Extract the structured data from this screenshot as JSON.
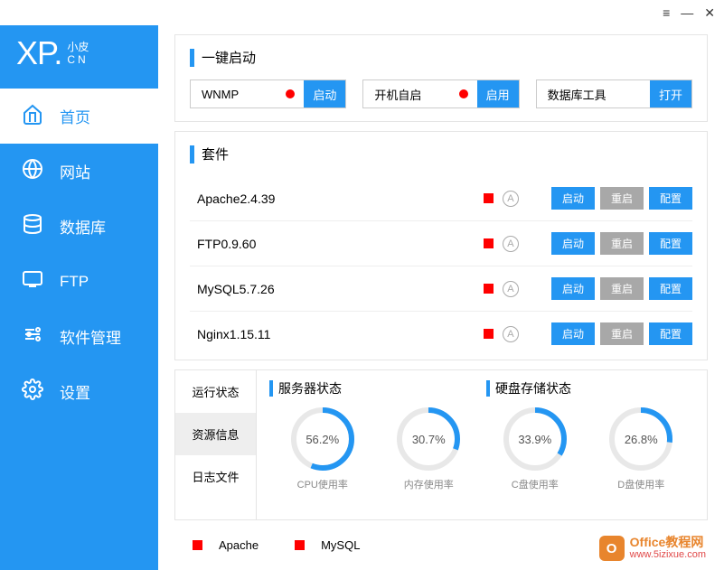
{
  "window": {
    "menu": "≡",
    "min": "—",
    "close": "✕"
  },
  "logo": {
    "main": "XP.",
    "sub1": "小皮",
    "sub2": "CN"
  },
  "nav": [
    {
      "key": "home",
      "label": "首页",
      "active": true
    },
    {
      "key": "site",
      "label": "网站",
      "active": false
    },
    {
      "key": "db",
      "label": "数据库",
      "active": false
    },
    {
      "key": "ftp",
      "label": "FTP",
      "active": false
    },
    {
      "key": "soft",
      "label": "软件管理",
      "active": false
    },
    {
      "key": "settings",
      "label": "设置",
      "active": false
    }
  ],
  "quickstart": {
    "title": "一键启动",
    "items": [
      {
        "label": "WNMP",
        "dot": true,
        "btn": "启动"
      },
      {
        "label": "开机自启",
        "dot": true,
        "btn": "启用"
      },
      {
        "label": "数据库工具",
        "dot": false,
        "btn": "打开"
      }
    ]
  },
  "suites": {
    "title": "套件",
    "rows": [
      {
        "name": "Apache2.4.39",
        "btns": [
          "启动",
          "重启",
          "配置"
        ]
      },
      {
        "name": "FTP0.9.60",
        "btns": [
          "启动",
          "重启",
          "配置"
        ]
      },
      {
        "name": "MySQL5.7.26",
        "btns": [
          "启动",
          "重启",
          "配置"
        ]
      },
      {
        "name": "Nginx1.15.11",
        "btns": [
          "启动",
          "重启",
          "配置"
        ]
      }
    ],
    "badge": "A"
  },
  "status": {
    "tabs": [
      "运行状态",
      "资源信息",
      "日志文件"
    ],
    "active_tab": 1,
    "header1": "服务器状态",
    "header2": "硬盘存储状态",
    "gauges": [
      {
        "pct": 56.2,
        "label": "CPU使用率"
      },
      {
        "pct": 30.7,
        "label": "内存使用率"
      },
      {
        "pct": 33.9,
        "label": "C盘使用率"
      },
      {
        "pct": 26.8,
        "label": "D盘使用率"
      }
    ]
  },
  "footer": {
    "items": [
      "Apache",
      "MySQL"
    ]
  },
  "watermark": {
    "badge": "O",
    "line1": "Office教程网",
    "line2": "www.5izixue.com"
  },
  "colors": {
    "accent": "#2496f2",
    "red": "#f00",
    "gray_btn": "#a8a8a8"
  }
}
